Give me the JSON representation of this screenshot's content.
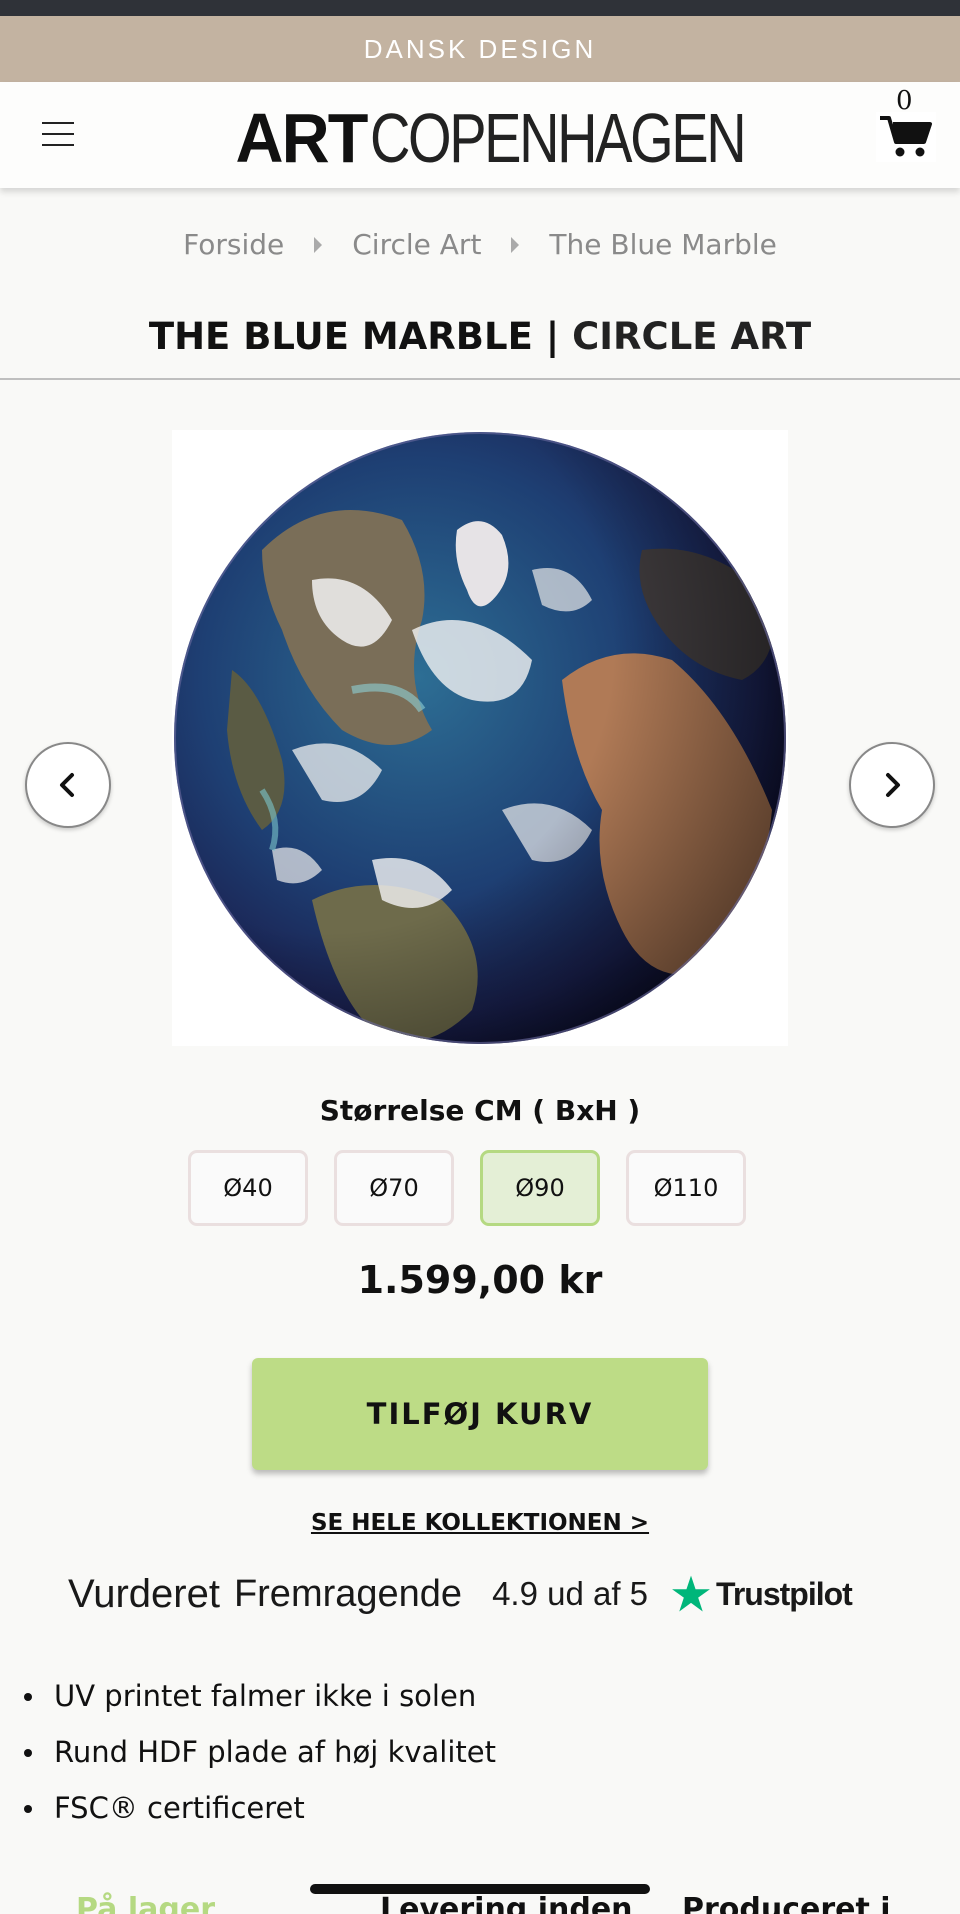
{
  "promo": {
    "text": "DANSK DESIGN"
  },
  "header": {
    "logo_bold": "ART",
    "logo_thin": "COPENHAGEN",
    "cart_count": "0"
  },
  "breadcrumb": [
    "Forside",
    "Circle Art",
    "The Blue Marble"
  ],
  "product": {
    "title_main": "THE BLUE MARBLE",
    "title_separator": " | ",
    "title_category": "CIRCLE ART",
    "size_label": "Størrelse CM ( BxH )",
    "sizes": [
      "Ø40",
      "Ø70",
      "Ø90",
      "Ø110"
    ],
    "selected_size": "Ø90",
    "price": "1.599,00 kr",
    "add_to_cart": "TILFØJ KURV",
    "collection_link": "SE HELE KOLLEKTIONEN >"
  },
  "rating": {
    "prefix": "Vurderet",
    "word": "Fremragende",
    "score": "4.9 ud af 5",
    "provider": "Trustpilot"
  },
  "features": [
    "UV printet falmer ikke i solen",
    "Rund HDF plade af høj kvalitet",
    "FSC® certificeret"
  ],
  "bottom_tabs": [
    "På lager",
    "Levering inden",
    "Produceret i"
  ],
  "colors": {
    "promo_bg": "#c3b3a1",
    "accent_green": "#bddc86",
    "selected_border": "#b5d982",
    "trustpilot_star": "#00b67a"
  },
  "icons": {
    "menu": "hamburger-icon",
    "cart": "cart-icon",
    "prev": "chevron-left-icon",
    "next": "chevron-right-icon",
    "rating": "trustpilot-star-icon"
  }
}
